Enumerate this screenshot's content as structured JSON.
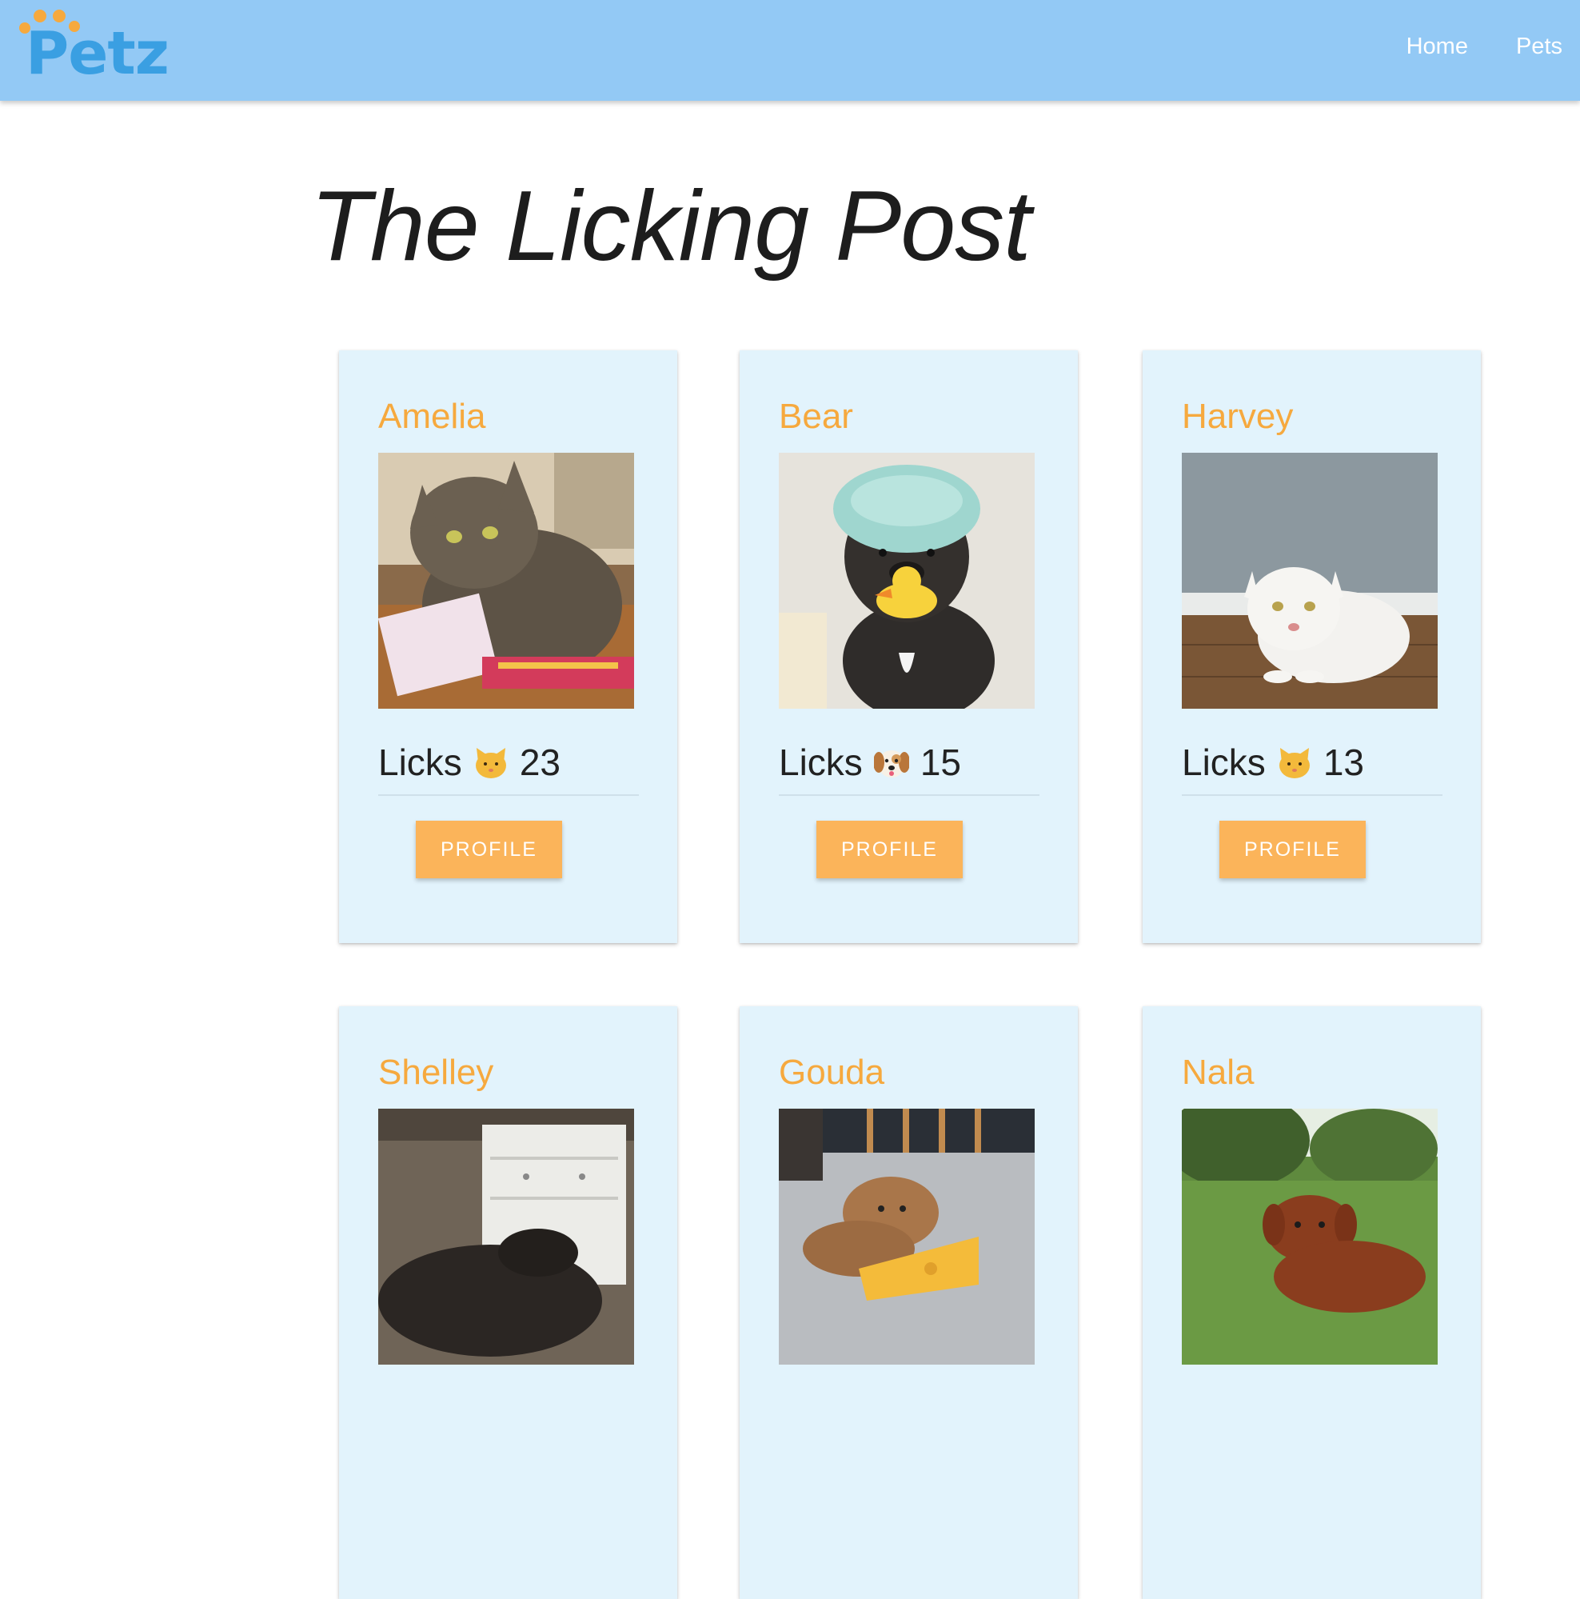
{
  "navbar": {
    "logo_text": "Petz",
    "links": [
      {
        "label": "Home"
      },
      {
        "label": "Pets"
      }
    ]
  },
  "page": {
    "title": "The Licking Post"
  },
  "cards": [
    {
      "name": "Amelia",
      "licks_label": "Licks",
      "species_icon": "cat-face-icon",
      "licks": "23",
      "button_label": "PROFILE"
    },
    {
      "name": "Bear",
      "licks_label": "Licks",
      "species_icon": "dog-face-icon",
      "licks": "15",
      "button_label": "PROFILE"
    },
    {
      "name": "Harvey",
      "licks_label": "Licks",
      "species_icon": "cat-face-icon",
      "licks": "13",
      "button_label": "PROFILE"
    },
    {
      "name": "Shelley"
    },
    {
      "name": "Gouda"
    },
    {
      "name": "Nala"
    }
  ],
  "colors": {
    "navbar_bg": "#93c9f5",
    "card_bg": "#e2f3fc",
    "accent_orange": "#f6a93e",
    "button_bg": "#fbb45a",
    "logo_blue": "#3a9fe2"
  }
}
